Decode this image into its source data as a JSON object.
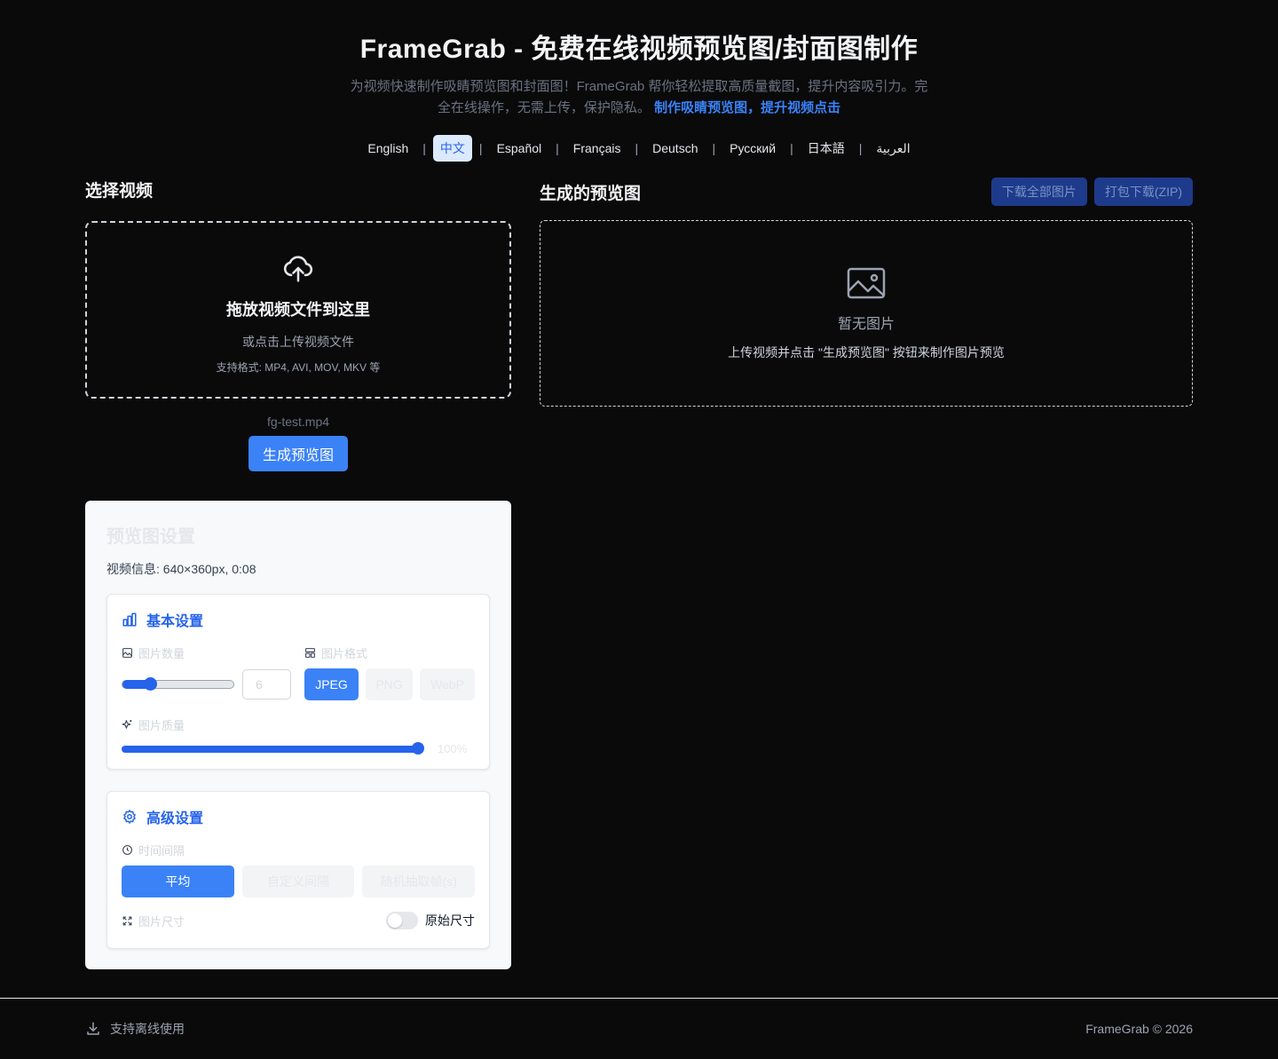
{
  "header": {
    "title": "FrameGrab - 免费在线视频预览图/封面图制作",
    "subtitle": "为视频快速制作吸睛预览图和封面图！FrameGrab 帮你轻松提取高质量截图，提升内容吸引力。完全在线操作，无需上传，保护隐私。",
    "subtitle_highlight": "制作吸睛预览图，提升视频点击"
  },
  "languages": [
    {
      "label": "English"
    },
    {
      "label": "中文",
      "active": true
    },
    {
      "label": "Español"
    },
    {
      "label": "Français"
    },
    {
      "label": "Deutsch"
    },
    {
      "label": "Русский"
    },
    {
      "label": "日本語"
    },
    {
      "label": "العربية"
    }
  ],
  "upload": {
    "section_title": "选择视频",
    "drop_title": "拖放视频文件到这里",
    "drop_sub": "或点击上传视频文件",
    "formats": "支持格式: MP4, AVI, MOV, MKV 等",
    "filename": "fg-test.mp4",
    "generate_label": "生成预览图"
  },
  "settings": {
    "title": "预览图设置",
    "video_info": "视频信息: 640×360px, 0:08",
    "basic": {
      "title": "基本设置",
      "count_label": "图片数量",
      "count_value": "6",
      "count_slider_fraction": 0.25,
      "format_label": "图片格式",
      "formats": [
        {
          "label": "JPEG",
          "active": true
        },
        {
          "label": "PNG"
        },
        {
          "label": "WebP"
        }
      ],
      "quality_label": "图片质量",
      "quality_value": "100%",
      "quality_fraction": 1.0
    },
    "advanced": {
      "title": "高级设置",
      "interval_label": "时间间隔",
      "intervals": [
        {
          "label": "平均",
          "active": true
        },
        {
          "label": "自定义间隔"
        },
        {
          "label": "随机抽取帧(s)"
        }
      ],
      "size_label": "图片尺寸",
      "original_size_label": "原始尺寸",
      "original_size_on": false
    }
  },
  "preview": {
    "section_title": "生成的预览图",
    "download_all": "下载全部图片",
    "download_zip": "打包下载(ZIP)",
    "empty_title": "暂无图片",
    "empty_sub": "上传视频并点击 \"生成预览图\" 按钮来制作图片预览"
  },
  "footer": {
    "offline": "支持离线使用",
    "copyright": "FrameGrab © 2026"
  },
  "colors": {
    "accent": "#3b82f6",
    "background": "#0a0a0b",
    "panel": "#f8f9fb"
  }
}
